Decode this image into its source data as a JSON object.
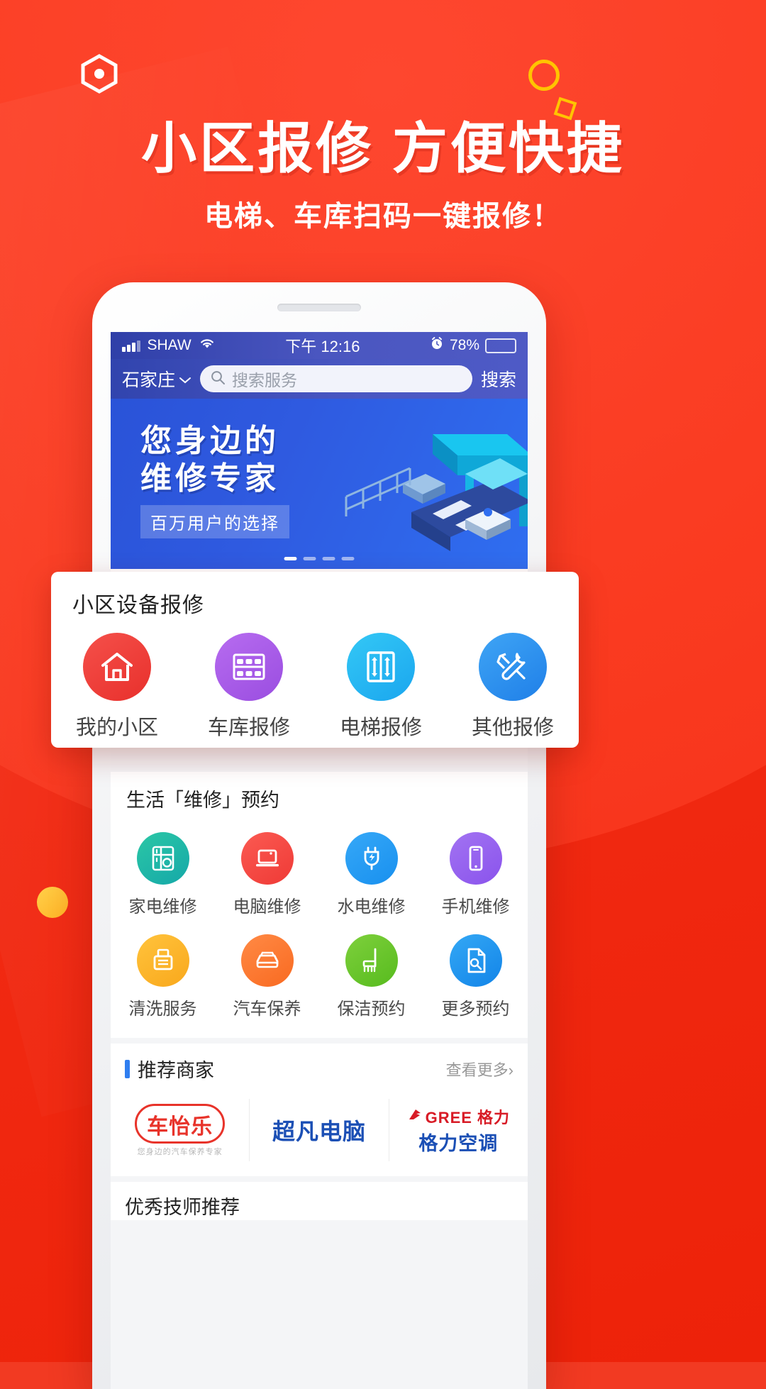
{
  "promo": {
    "title": "小区报修 方便快捷",
    "subtitle": "电梯、车库扫码一键报修！",
    "bg_color": "#f22b14",
    "accent_color": "#ffc400"
  },
  "status_bar": {
    "carrier": "SHAW",
    "time": "下午 12:16",
    "battery": "78%",
    "signal_icon": "signal-bars-icon",
    "wifi_icon": "wifi-icon",
    "alarm_icon": "alarm-clock-icon",
    "battery_icon": "battery-icon"
  },
  "search": {
    "city": "石家庄",
    "chevron_icon": "chevron-down-icon",
    "search_icon": "search-icon",
    "placeholder": "搜索服务",
    "button_label": "搜索"
  },
  "hero": {
    "line1": "您身边的",
    "line2": "维修专家",
    "tag": "百万用户的选择",
    "dots": 4,
    "active_dot": 0,
    "bg_color": "#2f5ae0"
  },
  "feature_card": {
    "title": "小区设备报修",
    "items": [
      {
        "label": "我的小区",
        "icon": "home-icon",
        "color1": "#f5504a",
        "color2": "#e8302c"
      },
      {
        "label": "车库报修",
        "icon": "garage-icon",
        "color1": "#b76cf0",
        "color2": "#9a4de0"
      },
      {
        "label": "电梯报修",
        "icon": "elevator-icon",
        "color1": "#34c8f5",
        "color2": "#1aa6ef"
      },
      {
        "label": "其他报修",
        "icon": "wrench-icon",
        "color1": "#3fa5f5",
        "color2": "#1f7fe8"
      }
    ]
  },
  "life_section": {
    "title": "生活「维修」预约",
    "items": [
      {
        "label": "家电维修",
        "icon": "appliance-icon",
        "color1": "#2bc7a6",
        "color2": "#15a8a8"
      },
      {
        "label": "电脑维修",
        "icon": "laptop-icon",
        "color1": "#fb5a52",
        "color2": "#ef3a36"
      },
      {
        "label": "水电维修",
        "icon": "plug-icon",
        "color1": "#36a8f7",
        "color2": "#1890ef"
      },
      {
        "label": "手机维修",
        "icon": "phone-icon",
        "color1": "#a273f2",
        "color2": "#8a53ec"
      },
      {
        "label": "清洗服务",
        "icon": "washer-icon",
        "color1": "#ffc33c",
        "color2": "#f9a81c"
      },
      {
        "label": "汽车保养",
        "icon": "car-icon",
        "color1": "#ff8a45",
        "color2": "#f96a21"
      },
      {
        "label": "保洁预约",
        "icon": "mop-icon",
        "color1": "#7ed03c",
        "color2": "#57bb1e"
      },
      {
        "label": "更多预约",
        "icon": "more-doc-icon",
        "color1": "#34a8f5",
        "color2": "#1284e8"
      }
    ]
  },
  "merchants": {
    "title": "推荐商家",
    "more_label": "查看更多",
    "more_icon": "chevron-right-icon",
    "items": [
      {
        "name": "车怡乐",
        "tagline": "您身边的汽车保养专家",
        "color": "#e8332a"
      },
      {
        "name": "超凡电脑",
        "color": "#1b4fb5"
      },
      {
        "name": "GREE 格力",
        "sub": "格力空调",
        "color": "#d81b26"
      }
    ]
  },
  "bottom_peek": {
    "text": "优秀技师推荐"
  },
  "promo_strip": {
    "chip1": "",
    "chip2": "",
    "button": ""
  }
}
